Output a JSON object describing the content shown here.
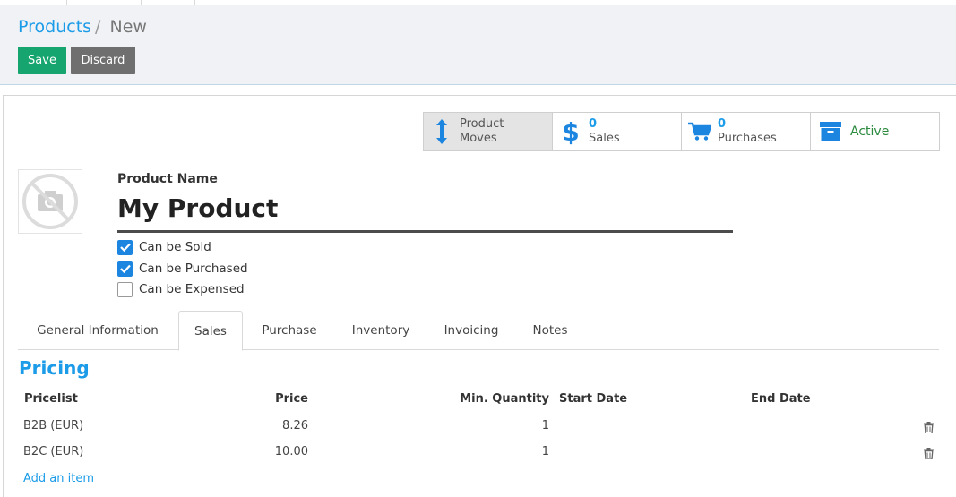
{
  "breadcrumb": {
    "parent": "Products",
    "separator": "/",
    "current": "New"
  },
  "buttons": {
    "save": "Save",
    "discard": "Discard"
  },
  "smart_buttons": {
    "moves": {
      "line1": "Product",
      "line2": "Moves",
      "icon": "updown-arrow-icon"
    },
    "sales": {
      "count": "0",
      "label": "Sales",
      "icon": "dollar-icon"
    },
    "purchases": {
      "count": "0",
      "label": "Purchases",
      "icon": "cart-icon"
    },
    "active": {
      "label": "Active",
      "icon": "archive-icon"
    }
  },
  "product": {
    "name_label": "Product Name",
    "name_value": "My Product",
    "checkboxes": [
      {
        "label": "Can be Sold",
        "checked": true
      },
      {
        "label": "Can be Purchased",
        "checked": true
      },
      {
        "label": "Can be Expensed",
        "checked": false
      }
    ]
  },
  "tabs": [
    "General Information",
    "Sales",
    "Purchase",
    "Inventory",
    "Invoicing",
    "Notes"
  ],
  "active_tab": "Sales",
  "pricing": {
    "title": "Pricing",
    "columns": [
      "Pricelist",
      "Price",
      "Min. Quantity",
      "Start Date",
      "End Date"
    ],
    "rows": [
      {
        "pricelist": "B2B (EUR)",
        "price": "8.26",
        "min_qty": "1",
        "start": "",
        "end": ""
      },
      {
        "pricelist": "B2C (EUR)",
        "price": "10.00",
        "min_qty": "1",
        "start": "",
        "end": ""
      }
    ],
    "add_item": "Add an item"
  },
  "colors": {
    "accent": "#1c9ce8",
    "save": "#17a56f",
    "discard": "#6f6f6f",
    "active": "#2b8a3e"
  }
}
